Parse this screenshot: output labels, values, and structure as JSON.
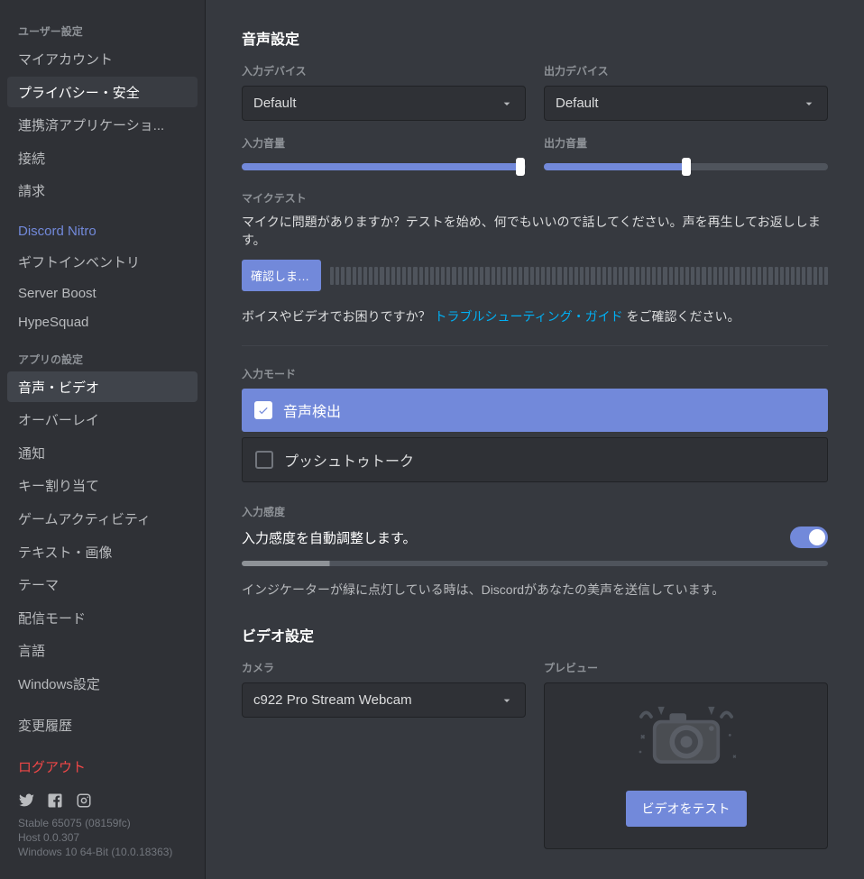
{
  "sidebar": {
    "groups": [
      {
        "header": "ユーザー設定",
        "items": [
          {
            "label": "マイアカウント"
          },
          {
            "label": "プライバシー・安全",
            "highlight": true
          },
          {
            "label": "連携済アプリケーショ..."
          },
          {
            "label": "接続"
          },
          {
            "label": "請求"
          }
        ]
      },
      {
        "header": null,
        "items": [
          {
            "label": "Discord Nitro",
            "blue": true
          },
          {
            "label": "ギフトインベントリ"
          },
          {
            "label": "Server Boost"
          },
          {
            "label": "HypeSquad"
          }
        ]
      },
      {
        "header": "アプリの設定",
        "items": [
          {
            "label": "音声・ビデオ",
            "selected": true
          },
          {
            "label": "オーバーレイ"
          },
          {
            "label": "通知"
          },
          {
            "label": "キー割り当て"
          },
          {
            "label": "ゲームアクティビティ"
          },
          {
            "label": "テキスト・画像"
          },
          {
            "label": "テーマ"
          },
          {
            "label": "配信モード"
          },
          {
            "label": "言語"
          },
          {
            "label": "Windows設定"
          }
        ]
      },
      {
        "header": null,
        "items": [
          {
            "label": "変更履歴"
          }
        ]
      }
    ],
    "logout": "ログアウト",
    "version": [
      "Stable 65075 (08159fc)",
      "Host 0.0.307",
      "Windows 10 64-Bit (10.0.18363)"
    ]
  },
  "main": {
    "voice_title": "音声設定",
    "input_device_label": "入力デバイス",
    "input_device_value": "Default",
    "output_device_label": "出力デバイス",
    "output_device_value": "Default",
    "input_volume_label": "入力音量",
    "input_volume_percent": 98,
    "output_volume_label": "出力音量",
    "output_volume_percent": 50,
    "mic_test_label": "マイクテスト",
    "mic_test_desc": "マイクに問題がありますか？テストを始め、何でもいいので話してください。声を再生してお返しします。",
    "mic_test_button": "確認しまし...",
    "guide_before": "ボイスやビデオでお困りですか？ ",
    "guide_link": "トラブルシューティング・ガイド",
    "guide_after": " をご確認ください。",
    "input_mode_label": "入力モード",
    "mode_voice_detect": "音声検出",
    "mode_ptt": "プッシュトゥトーク",
    "sens_label": "入力感度",
    "sens_toggle_label": "入力感度を自動調整します。",
    "sens_toggle_on": true,
    "sens_hint": "インジケーターが緑に点灯している時は、Discordがあなたの美声を送信しています。",
    "video_title": "ビデオ設定",
    "camera_label": "カメラ",
    "camera_value": "c922 Pro Stream Webcam",
    "preview_label": "プレビュー",
    "test_video_button": "ビデオをテスト"
  }
}
